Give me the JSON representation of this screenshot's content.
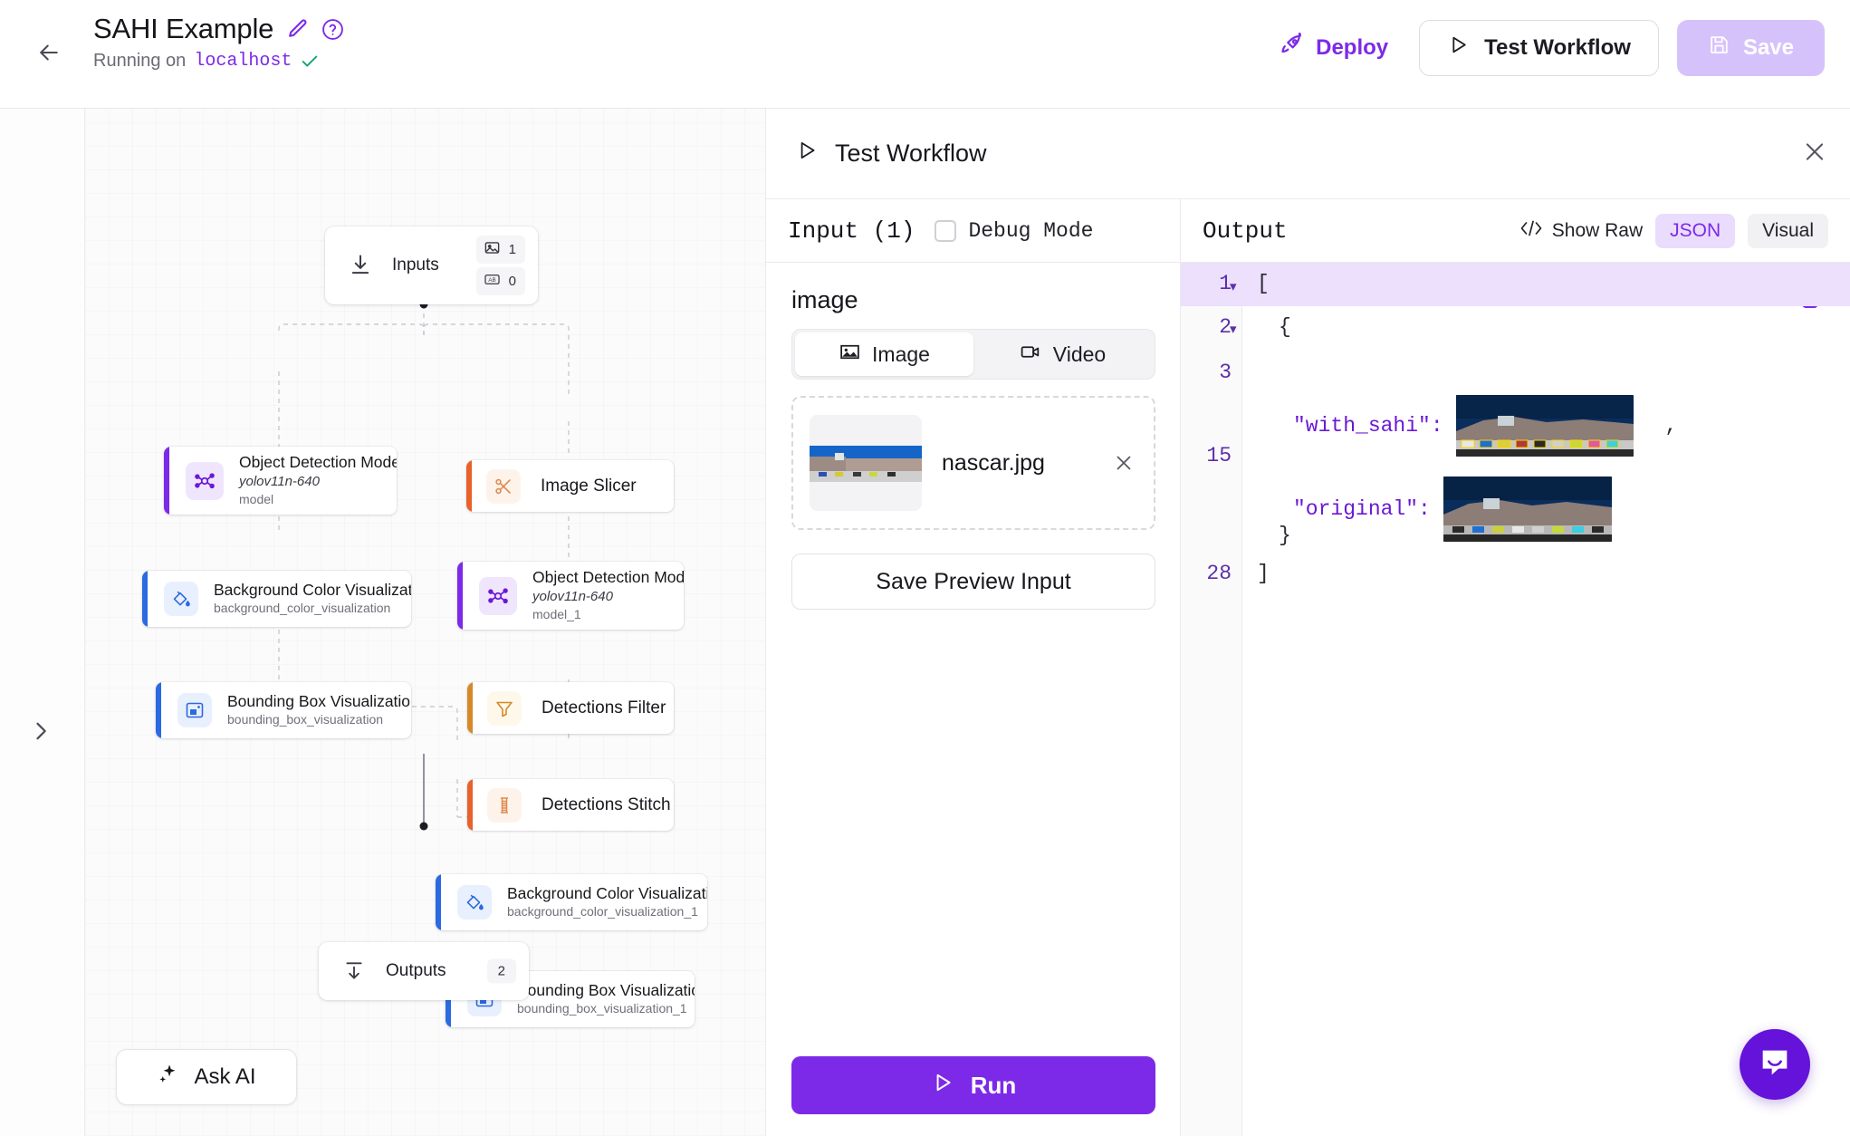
{
  "topbar": {
    "back_icon": "arrow-left-icon",
    "workflow_title": "SAHI Example",
    "edit_icon": "pencil-icon",
    "help_icon": "question-circle-icon",
    "running_prefix": "Running on",
    "running_host": "localhost",
    "status_icon": "check-icon",
    "deploy_label": "Deploy",
    "deploy_icon": "rocket-icon",
    "test_workflow_label": "Test Workflow",
    "test_workflow_icon": "play-icon",
    "save_label": "Save",
    "save_icon": "floppy-disk-icon"
  },
  "canvas": {
    "expand_icon": "chevron-right-icon",
    "ask_ai_label": "Ask AI",
    "ask_ai_icon": "sparkles-icon",
    "inputs_node": {
      "label": "Inputs",
      "icon": "download-arrow-icon",
      "badges": [
        {
          "icon": "image-icon",
          "count": "1"
        },
        {
          "icon": "text-ab-icon",
          "count": "0"
        }
      ]
    },
    "outputs_node": {
      "label": "Outputs",
      "icon": "upload-arrow-icon",
      "count": "2"
    },
    "nodes": [
      {
        "id": "object-detection-model",
        "title": "Object Detection Model",
        "version": "yolov11n-640",
        "subtitle": "model",
        "icon": "model-graph-icon",
        "accent": "#7c2ae8",
        "icon_bg": "#efe6fd",
        "icon_color": "#6b18d6"
      },
      {
        "id": "image-slicer",
        "title": "Image Slicer",
        "version": "",
        "subtitle": "",
        "icon": "scissors-icon",
        "accent": "#e8622a",
        "icon_bg": "#fdf1e8",
        "icon_color": "#e08a50"
      },
      {
        "id": "background-color-visualization",
        "title": "Background Color Visualization",
        "version": "",
        "subtitle": "background_color_visualization",
        "icon": "paint-bucket-icon",
        "accent": "#2b6ae0",
        "icon_bg": "#e6eefd",
        "icon_color": "#2b6ae0"
      },
      {
        "id": "object-detection-model-1",
        "title": "Object Detection Model",
        "version": "yolov11n-640",
        "subtitle": "model_1",
        "icon": "model-graph-icon",
        "accent": "#7c2ae8",
        "icon_bg": "#efe6fd",
        "icon_color": "#6b18d6"
      },
      {
        "id": "bounding-box-visualization",
        "title": "Bounding Box Visualization",
        "version": "",
        "subtitle": "bounding_box_visualization",
        "icon": "bounding-box-icon",
        "accent": "#2b6ae0",
        "icon_bg": "#e6eefd",
        "icon_color": "#2b6ae0"
      },
      {
        "id": "detections-filter",
        "title": "Detections Filter",
        "version": "",
        "subtitle": "",
        "icon": "funnel-icon",
        "accent": "#d58a2a",
        "icon_bg": "#fdf6e6",
        "icon_color": "#d58a2a"
      },
      {
        "id": "detections-stitch",
        "title": "Detections Stitch",
        "version": "",
        "subtitle": "",
        "icon": "stitch-spool-icon",
        "accent": "#e8622a",
        "icon_bg": "#fdf1e8",
        "icon_color": "#e08a50"
      },
      {
        "id": "background-color-visualization-1",
        "title": "Background Color Visualization",
        "version": "",
        "subtitle": "background_color_visualization_1",
        "icon": "paint-bucket-icon",
        "accent": "#2b6ae0",
        "icon_bg": "#e6eefd",
        "icon_color": "#2b6ae0"
      },
      {
        "id": "bounding-box-visualization-1",
        "title": "Bounding Box Visualization",
        "version": "",
        "subtitle": "bounding_box_visualization_1",
        "icon": "bounding-box-icon",
        "accent": "#2b6ae0",
        "icon_bg": "#e6eefd",
        "icon_color": "#2b6ae0"
      }
    ]
  },
  "test_panel": {
    "title": "Test Workflow",
    "title_icon": "play-icon",
    "close_icon": "close-icon",
    "input": {
      "header": "Input (1)",
      "debug_mode_label": "Debug Mode",
      "debug_mode_checked": false,
      "field_label": "image",
      "tabs": [
        {
          "label": "Image",
          "icon": "image-icon",
          "active": true
        },
        {
          "label": "Video",
          "icon": "video-camera-icon",
          "active": false
        }
      ],
      "file_name": "nascar.jpg",
      "file_remove_icon": "close-icon",
      "save_preview_label": "Save Preview Input",
      "run_label": "Run",
      "run_icon": "play-icon"
    },
    "output": {
      "header": "Output",
      "show_raw_label": "Show Raw",
      "show_raw_icon": "code-brackets-icon",
      "view_modes": [
        {
          "label": "JSON",
          "active": true
        },
        {
          "label": "Visual",
          "active": false
        }
      ],
      "copy_icon": "copy-icon",
      "lines": [
        {
          "num": "1",
          "text": "[",
          "highlight": true,
          "foldable": true,
          "key": "",
          "image": ""
        },
        {
          "num": "2",
          "text": "{",
          "highlight": false,
          "foldable": true,
          "key": "",
          "image": ""
        },
        {
          "num": "3",
          "text": "",
          "highlight": false,
          "foldable": false,
          "key": "\"with_sahi\":",
          "image": "nascar-with-sahi",
          "trailing": ","
        },
        {
          "num": "15",
          "text": "",
          "highlight": false,
          "foldable": false,
          "key": "\"original\":",
          "image": "nascar-original",
          "trailing": ""
        },
        {
          "num": "",
          "text": "}",
          "highlight": false,
          "foldable": false,
          "key": "",
          "image": ""
        },
        {
          "num": "28",
          "text": "]",
          "highlight": false,
          "foldable": false,
          "key": "",
          "image": ""
        }
      ]
    }
  },
  "chat": {
    "icon": "messenger-chat-icon",
    "color": "#6512da"
  }
}
